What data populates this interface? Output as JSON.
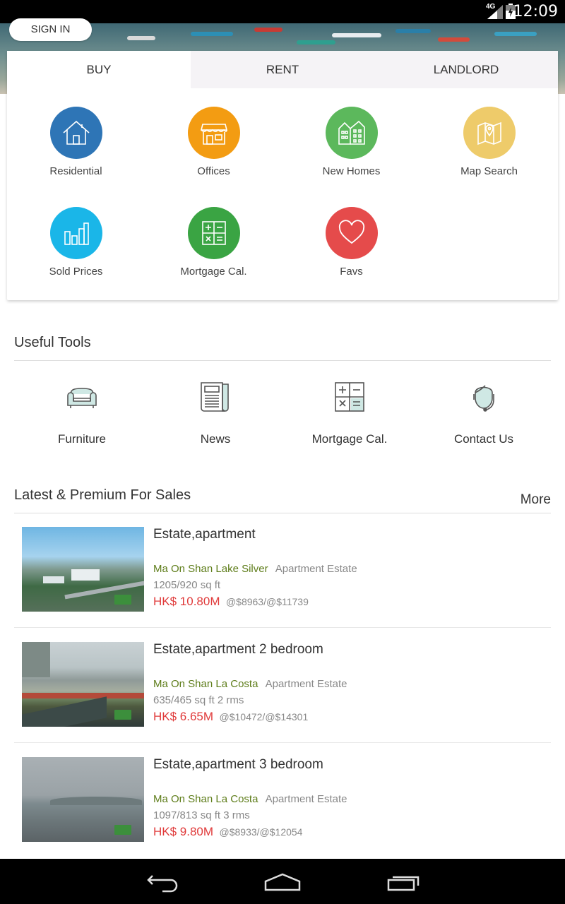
{
  "status_bar": {
    "network": "4G",
    "time": "12:09"
  },
  "header": {
    "sign_in_label": "SIGN IN"
  },
  "tabs": [
    {
      "label": "BUY",
      "active": true
    },
    {
      "label": "RENT",
      "active": false
    },
    {
      "label": "LANDLORD",
      "active": false
    }
  ],
  "categories": [
    {
      "label": "Residential",
      "icon": "house-icon",
      "color": "#2e75b6"
    },
    {
      "label": "Offices",
      "icon": "storefront-icon",
      "color": "#f39c12"
    },
    {
      "label": "New Homes",
      "icon": "buildings-icon",
      "color": "#5cb85c"
    },
    {
      "label": "Map Search",
      "icon": "map-pin-icon",
      "color": "#eecb6a"
    },
    {
      "label": "Sold Prices",
      "icon": "bar-chart-icon",
      "color": "#1ab6e8"
    },
    {
      "label": "Mortgage Cal.",
      "icon": "calculator-icon",
      "color": "#3aa443"
    },
    {
      "label": "Favs",
      "icon": "heart-icon",
      "color": "#e54b4b"
    }
  ],
  "useful_tools": {
    "title": "Useful Tools",
    "items": [
      {
        "label": "Furniture",
        "icon": "sofa-icon"
      },
      {
        "label": "News",
        "icon": "newspaper-icon"
      },
      {
        "label": "Mortgage Cal.",
        "icon": "calculator-icon"
      },
      {
        "label": "Contact Us",
        "icon": "headset-icon"
      }
    ]
  },
  "latest": {
    "title": "Latest & Premium For Sales",
    "more_label": "More",
    "listings": [
      {
        "title": "Estate,apartment",
        "estate": "Ma On Shan Lake Silver",
        "type": "Apartment Estate",
        "area": "1205/920 sq ft",
        "price": "HK$ 10.80M",
        "unit_price": "@$8963/@$11739"
      },
      {
        "title": "Estate,apartment  2 bedroom",
        "estate": "Ma On Shan La Costa",
        "type": "Apartment Estate",
        "area": "635/465 sq ft 2 rms",
        "price": "HK$ 6.65M",
        "unit_price": "@$10472/@$14301"
      },
      {
        "title": "Estate,apartment  3 bedroom",
        "estate": "Ma On Shan La Costa",
        "type": "Apartment Estate",
        "area": "1097/813 sq ft 3 rms",
        "price": "HK$ 9.80M",
        "unit_price": "@$8933/@$12054"
      }
    ]
  },
  "nav_bar": {
    "buttons": [
      "back-icon",
      "home-icon",
      "recents-icon"
    ]
  }
}
